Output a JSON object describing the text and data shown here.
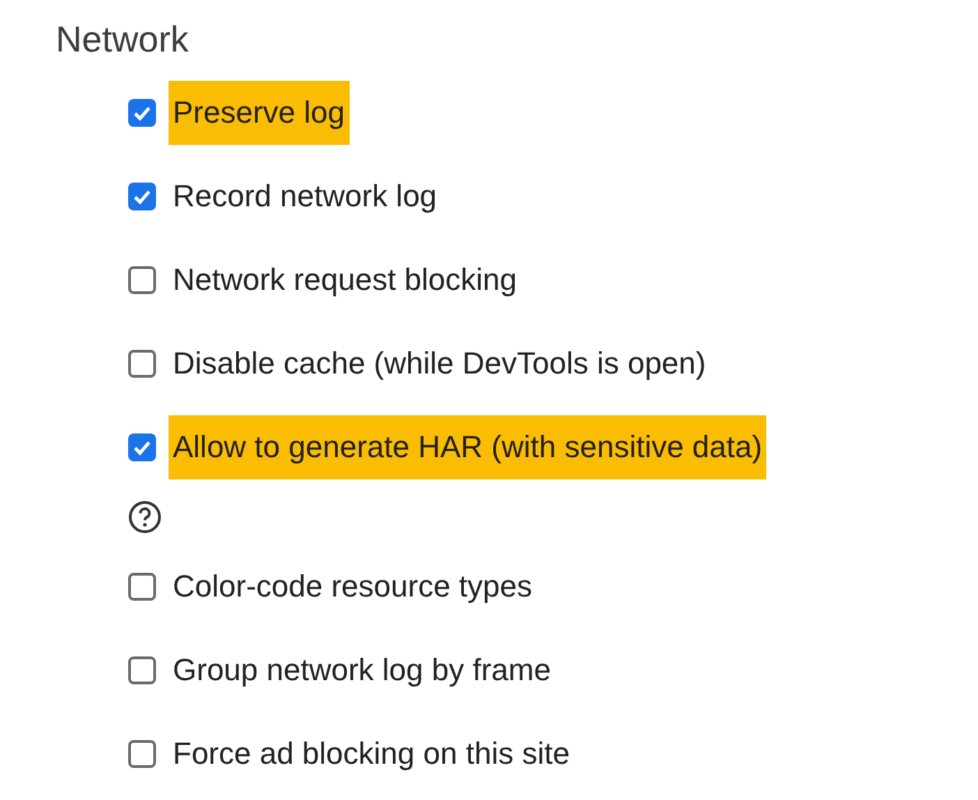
{
  "section": {
    "title": "Network"
  },
  "items": [
    {
      "kind": "checkbox",
      "label": "Preserve log",
      "checked": true,
      "highlighted": true
    },
    {
      "kind": "checkbox",
      "label": "Record network log",
      "checked": true,
      "highlighted": false
    },
    {
      "kind": "checkbox",
      "label": "Network request blocking",
      "checked": false,
      "highlighted": false
    },
    {
      "kind": "checkbox",
      "label": "Disable cache (while DevTools is open)",
      "checked": false,
      "highlighted": false
    },
    {
      "kind": "checkbox",
      "label": "Allow to generate HAR (with sensitive data)",
      "checked": true,
      "highlighted": true
    },
    {
      "kind": "help"
    },
    {
      "kind": "checkbox",
      "label": "Color-code resource types",
      "checked": false,
      "highlighted": false
    },
    {
      "kind": "checkbox",
      "label": "Group network log by frame",
      "checked": false,
      "highlighted": false
    },
    {
      "kind": "checkbox",
      "label": "Force ad blocking on this site",
      "checked": false,
      "highlighted": false
    }
  ]
}
